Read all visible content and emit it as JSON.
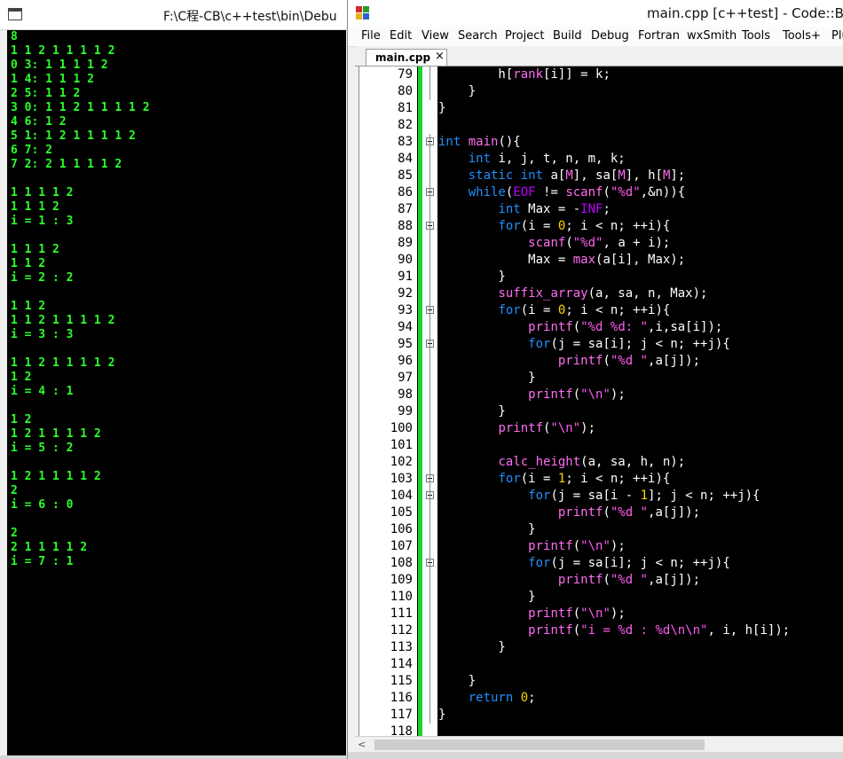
{
  "console": {
    "title": "F:\\C程-CB\\c++test\\bin\\Debu",
    "output_lines": [
      "8",
      "1 1 2 1 1 1 1 2",
      "0 3: 1 1 1 1 2",
      "1 4: 1 1 1 2",
      "2 5: 1 1 2",
      "3 0: 1 1 2 1 1 1 1 2",
      "4 6: 1 2",
      "5 1: 1 2 1 1 1 1 2",
      "6 7: 2",
      "7 2: 2 1 1 1 1 2",
      "",
      "1 1 1 1 2",
      "1 1 1 2",
      "i = 1 : 3",
      "",
      "1 1 1 2",
      "1 1 2",
      "i = 2 : 2",
      "",
      "1 1 2",
      "1 1 2 1 1 1 1 2",
      "i = 3 : 3",
      "",
      "1 1 2 1 1 1 1 2",
      "1 2",
      "i = 4 : 1",
      "",
      "1 2",
      "1 2 1 1 1 1 2",
      "i = 5 : 2",
      "",
      "1 2 1 1 1 1 2",
      "2",
      "i = 6 : 0",
      "",
      "2",
      "2 1 1 1 1 2",
      "i = 7 : 1"
    ]
  },
  "ide": {
    "title": "main.cpp [c++test] - Code::Blo",
    "menu": [
      "File",
      "Edit",
      "View",
      "Search",
      "Project",
      "Build",
      "Debug",
      "Fortran",
      "wxSmith",
      "Tools",
      "Tools+",
      "Plu"
    ],
    "tab_label": "main.cpp",
    "tab_close": "×",
    "accent_colors": {
      "changebar": "#1fd12f",
      "keyword": "#1e90ff",
      "string": "#ff5cf0",
      "number": "#ffd400"
    },
    "code_lines": [
      {
        "n": "79",
        "text": "        h[rank[i]] = k;"
      },
      {
        "n": "80",
        "text": "    }"
      },
      {
        "n": "81",
        "text": "}"
      },
      {
        "n": "82",
        "text": ""
      },
      {
        "n": "83",
        "text": "int main(){"
      },
      {
        "n": "84",
        "text": "    int i, j, t, n, m, k;"
      },
      {
        "n": "85",
        "text": "    static int a[M], sa[M], h[M];"
      },
      {
        "n": "86",
        "text": "    while(EOF != scanf(\"%d\",&n)){"
      },
      {
        "n": "87",
        "text": "        int Max = -INF;"
      },
      {
        "n": "88",
        "text": "        for(i = 0; i < n; ++i){"
      },
      {
        "n": "89",
        "text": "            scanf(\"%d\", a + i);"
      },
      {
        "n": "90",
        "text": "            Max = max(a[i], Max);"
      },
      {
        "n": "91",
        "text": "        }"
      },
      {
        "n": "92",
        "text": "        suffix_array(a, sa, n, Max);"
      },
      {
        "n": "93",
        "text": "        for(i = 0; i < n; ++i){"
      },
      {
        "n": "94",
        "text": "            printf(\"%d %d: \",i,sa[i]);"
      },
      {
        "n": "95",
        "text": "            for(j = sa[i]; j < n; ++j){"
      },
      {
        "n": "96",
        "text": "                printf(\"%d \",a[j]);"
      },
      {
        "n": "97",
        "text": "            }"
      },
      {
        "n": "98",
        "text": "            printf(\"\\n\");"
      },
      {
        "n": "99",
        "text": "        }"
      },
      {
        "n": "100",
        "text": "        printf(\"\\n\");"
      },
      {
        "n": "101",
        "text": ""
      },
      {
        "n": "102",
        "text": "        calc_height(a, sa, h, n);"
      },
      {
        "n": "103",
        "text": "        for(i = 1; i < n; ++i){"
      },
      {
        "n": "104",
        "text": "            for(j = sa[i - 1]; j < n; ++j){"
      },
      {
        "n": "105",
        "text": "                printf(\"%d \",a[j]);"
      },
      {
        "n": "106",
        "text": "            }"
      },
      {
        "n": "107",
        "text": "            printf(\"\\n\");"
      },
      {
        "n": "108",
        "text": "            for(j = sa[i]; j < n; ++j){"
      },
      {
        "n": "109",
        "text": "                printf(\"%d \",a[j]);"
      },
      {
        "n": "110",
        "text": "            }"
      },
      {
        "n": "111",
        "text": "            printf(\"\\n\");"
      },
      {
        "n": "112",
        "text": "            printf(\"i = %d : %d\\n\\n\", i, h[i]);"
      },
      {
        "n": "113",
        "text": "        }"
      },
      {
        "n": "114",
        "text": ""
      },
      {
        "n": "115",
        "text": "    }"
      },
      {
        "n": "116",
        "text": "    return 0;"
      },
      {
        "n": "117",
        "text": "}"
      },
      {
        "n": "118",
        "text": ""
      }
    ],
    "fold_markers": [
      "83",
      "86",
      "88",
      "93",
      "95",
      "103",
      "104",
      "108"
    ]
  }
}
